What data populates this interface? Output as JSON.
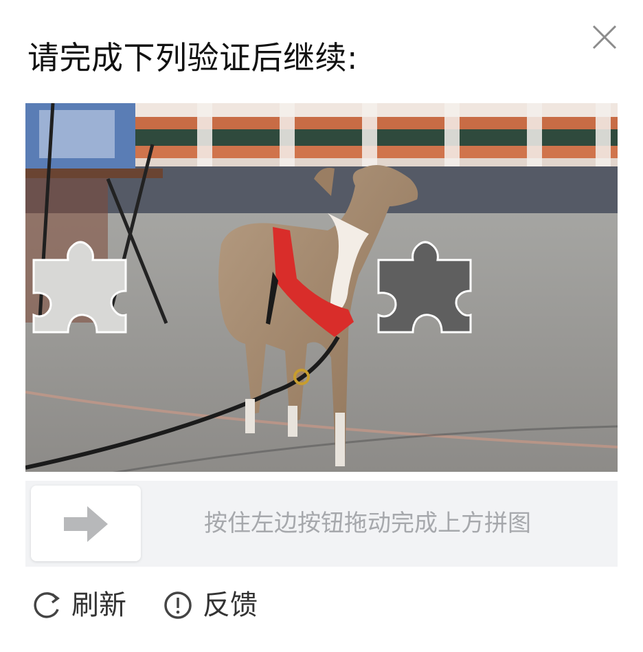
{
  "dialog": {
    "title": "请完成下列验证后继续:"
  },
  "slider": {
    "hint": "按住左边按钮拖动完成上方拼图"
  },
  "footer": {
    "refresh_label": "刷新",
    "feedback_label": "反馈"
  },
  "icons": {
    "close": "close-icon",
    "arrow": "arrow-right-icon",
    "refresh": "refresh-icon",
    "feedback": "exclamation-circle-icon"
  },
  "colors": {
    "title": "#111111",
    "hint": "#a6a8ac",
    "track": "#f2f3f5",
    "icon_gray": "#b7b8ba",
    "footer_text": "#333333"
  }
}
